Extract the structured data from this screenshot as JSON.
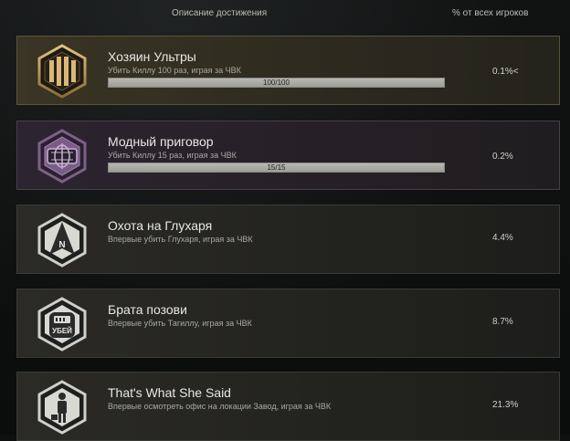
{
  "header": {
    "description": "Описание достижения",
    "percent": "% от всех игроков"
  },
  "achievements": [
    {
      "title": "Хозяин Ультры",
      "description": "Убить Киллу 100 раз, играя за ЧВК",
      "progress_text": "100/100",
      "progress": 1.0,
      "percent": "0.1%<",
      "icon": "gold-bars-icon"
    },
    {
      "title": "Модный приговор",
      "description": "Убить Киллу 15 раз, играя за ЧВК",
      "progress_text": "15/15",
      "progress": 1.0,
      "percent": "0.2%",
      "icon": "purple-globe-icon"
    },
    {
      "title": "Охота на Глухаря",
      "description": "Впервые убить Глухаря, играя за ЧВК",
      "percent": "4.4%",
      "icon": "compass-n-icon",
      "icon_letter": "N"
    },
    {
      "title": "Брата позови",
      "description": "Впервые убить Тагиллу, играя за ЧВК",
      "percent": "8.7%",
      "icon": "mask-icon",
      "icon_letter": "УБЕЙ"
    },
    {
      "title": "That's What She Said",
      "description": "Впервые осмотреть офис на локации Завод, играя за ЧВК",
      "percent": "21.3%",
      "icon": "office-worker-icon"
    }
  ]
}
